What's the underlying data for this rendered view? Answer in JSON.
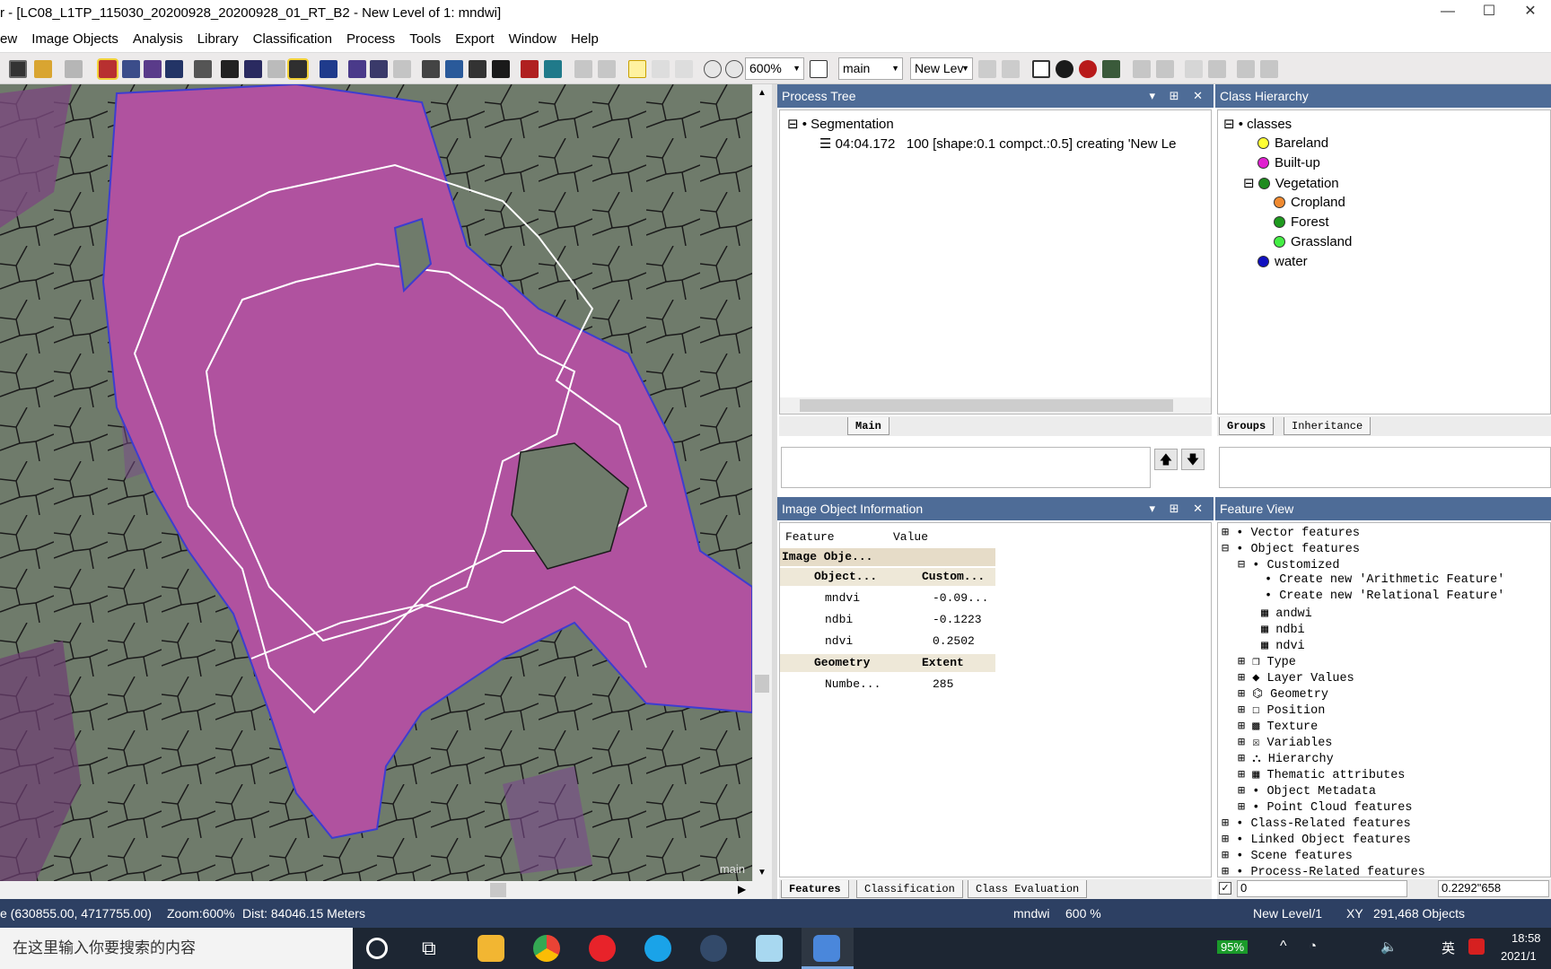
{
  "window": {
    "title": "r - [LC08_L1TP_115030_20200928_20200928_01_RT_B2 - New Level of 1: mndwi]",
    "controls": [
      "—",
      "☐",
      "✕"
    ]
  },
  "menu": [
    "ew",
    "Image Objects",
    "Analysis",
    "Library",
    "Classification",
    "Process",
    "Tools",
    "Export",
    "Window",
    "Help"
  ],
  "toolbar": {
    "zoom_value": "600%",
    "map_value": "main",
    "level_value": "New Lev"
  },
  "map": {
    "overlay_label": "main"
  },
  "process_tree": {
    "title": "Process Tree",
    "root": "Segmentation",
    "child_time": "04:04.172",
    "child_text": "100 [shape:0.1 compct.:0.5] creating 'New Le",
    "tab": "Main"
  },
  "class_hierarchy": {
    "title": "Class Hierarchy",
    "root": "classes",
    "items": [
      {
        "label": "Bareland",
        "color": "#ffff33",
        "indent": 1
      },
      {
        "label": "Built-up",
        "color": "#e020d0",
        "indent": 1
      },
      {
        "label": "Vegetation",
        "color": "#1e8a1e",
        "indent": 1
      },
      {
        "label": "Cropland",
        "color": "#f08a30",
        "indent": 2
      },
      {
        "label": "Forest",
        "color": "#1e9a1e",
        "indent": 2
      },
      {
        "label": "Grassland",
        "color": "#44ee44",
        "indent": 2
      },
      {
        "label": "water",
        "color": "#1010c0",
        "indent": 1
      }
    ],
    "tabs": [
      "Groups",
      "Inheritance"
    ]
  },
  "image_object_info": {
    "title": "Image Object Information",
    "col_feature": "Feature",
    "col_value": "Value",
    "section1": "Image Obje...",
    "group1_name": "Object...",
    "group1_value": "Custom...",
    "rows": [
      {
        "name": "mndvi",
        "value": "-0.09..."
      },
      {
        "name": "ndbi",
        "value": "-0.1223"
      },
      {
        "name": "ndvi",
        "value": "0.2502"
      }
    ],
    "group2_name": "Geometry",
    "group2_value": "Extent",
    "row_last": {
      "name": "Numbe...",
      "value": "285"
    },
    "tabs": [
      "Features",
      "Classification",
      "Class Evaluation"
    ]
  },
  "feature_view": {
    "title": "Feature View",
    "items": [
      "Vector features",
      "Object features",
      "Customized",
      "Create new 'Arithmetic Feature'",
      "Create new 'Relational Feature'",
      "andwi",
      "ndbi",
      "ndvi",
      "Type",
      "Layer Values",
      "Geometry",
      "Position",
      "Texture",
      "Variables",
      "Hierarchy",
      "Thematic attributes",
      "Object Metadata",
      "Point Cloud features",
      "Class-Related features",
      "Linked Object features",
      "Scene features",
      "Process-Related features"
    ],
    "input_left": "0",
    "input_right": "0.2292\"658"
  },
  "status": {
    "coords": "e (630855.00, 4717755.00)",
    "zoom": "Zoom:600%",
    "dist": "Dist: 84046.15 Meters",
    "layer": "mndwi",
    "zoom2": "600 %",
    "level": "New Level/1",
    "xy": "XY",
    "objects": "291,468 Objects"
  },
  "taskbar": {
    "search_placeholder": "在这里输入你要搜索的内容",
    "battery": "95%",
    "ime": "英",
    "time": "18:58",
    "date": "2021/1"
  }
}
